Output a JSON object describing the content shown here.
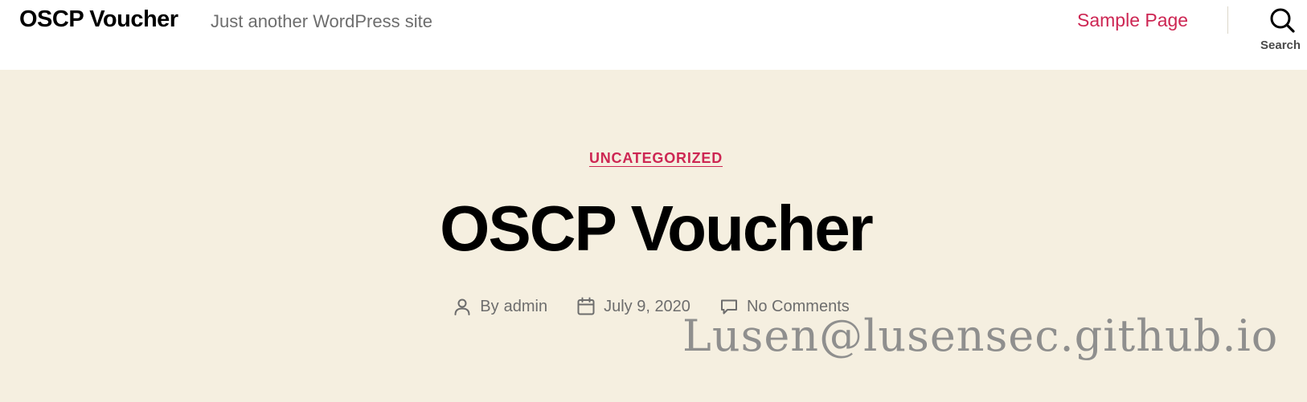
{
  "header": {
    "site_title": "OSCP Voucher",
    "site_description": "Just another WordPress site",
    "menu": [
      {
        "label": "Sample Page"
      }
    ],
    "search": {
      "label": "Search",
      "icon": "search-icon"
    }
  },
  "entry": {
    "category": "UNCATEGORIZED",
    "title": "OSCP Voucher",
    "meta": {
      "author_prefix": "By",
      "author": "admin",
      "author_icon": "user-icon",
      "date": "July 9, 2020",
      "date_icon": "calendar-icon",
      "comments": "No Comments",
      "comments_icon": "comment-icon"
    }
  },
  "watermark": "Lusen@lusensec.github.io",
  "colors": {
    "accent": "#cd2653",
    "header_bg": "#ffffff",
    "entry_bg": "#f5efe0",
    "secondary_text": "#6d6d6d",
    "title_text": "#000000"
  }
}
